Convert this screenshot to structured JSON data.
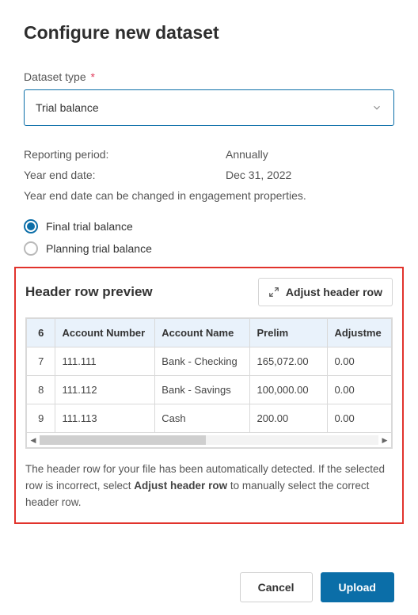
{
  "title": "Configure new dataset",
  "dataset_type": {
    "label": "Dataset type",
    "required": "*",
    "value": "Trial balance"
  },
  "info": {
    "reporting_period_label": "Reporting period:",
    "reporting_period_value": "Annually",
    "year_end_label": "Year end date:",
    "year_end_value": "Dec 31, 2022",
    "hint": "Year end date can be changed in engagement properties."
  },
  "radios": {
    "final": "Final trial balance",
    "planning": "Planning trial balance",
    "selected": "final"
  },
  "preview": {
    "title": "Header row preview",
    "adjust_label": "Adjust header row",
    "header_row_index": "6",
    "columns": [
      "Account Number",
      "Account Name",
      "Prelim",
      "Adjustme"
    ],
    "rows": [
      {
        "idx": "7",
        "cells": [
          "111.111",
          "Bank - Checking",
          "165,072.00",
          "0.00"
        ]
      },
      {
        "idx": "8",
        "cells": [
          "111.112",
          "Bank - Savings",
          "100,000.00",
          "0.00"
        ]
      },
      {
        "idx": "9",
        "cells": [
          "111.113",
          "Cash",
          "200.00",
          "0.00"
        ]
      }
    ],
    "desc_a": "The header row for your file has been automatically detected. If the selected row is incorrect, select ",
    "desc_bold": "Adjust header row",
    "desc_b": " to manually select the correct header row."
  },
  "footer": {
    "cancel": "Cancel",
    "upload": "Upload"
  }
}
